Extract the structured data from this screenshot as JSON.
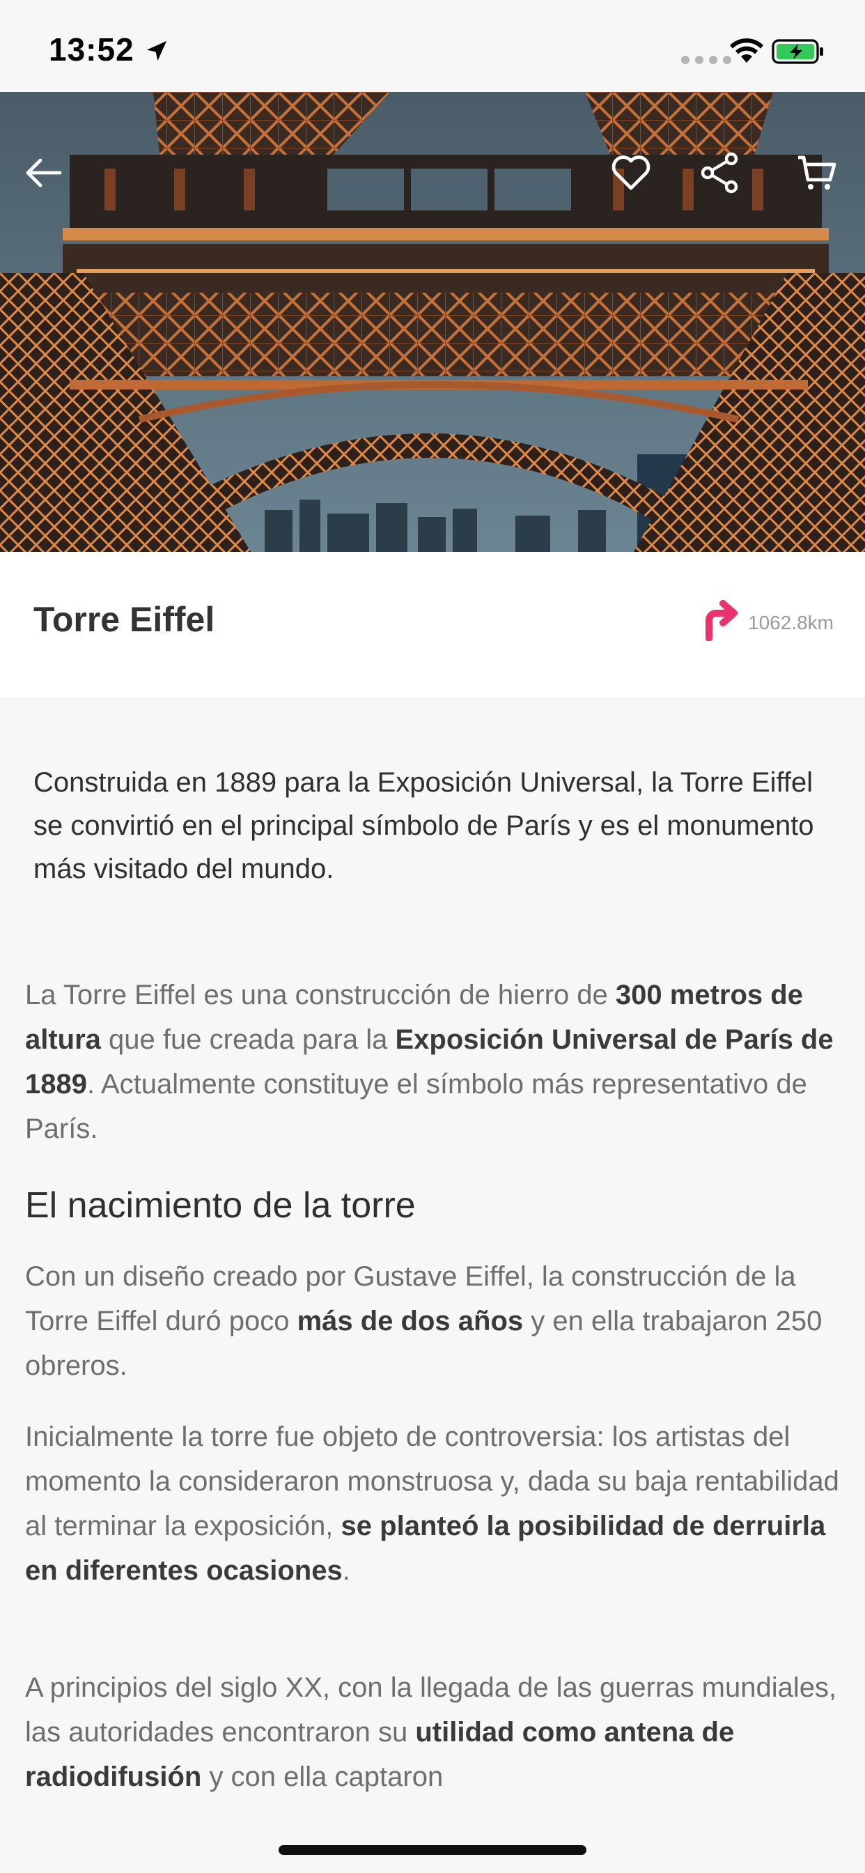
{
  "status_bar": {
    "time": "13:52"
  },
  "colors": {
    "accent": "#e8336f",
    "background": "#f7f7f7"
  },
  "hero": {
    "icons": [
      "back-arrow-icon",
      "heart-icon",
      "share-icon",
      "cart-icon"
    ]
  },
  "place": {
    "title": "Torre Eiffel",
    "distance": "1062.8km"
  },
  "content": {
    "intro": "Construida en 1889 para la Exposición Universal, la Torre Eiffel se convirtió en el principal símbolo de París y es el monumento más visitado del mundo.",
    "p1": {
      "t1": "La Torre Eiffel es una construcción de hierro de ",
      "b1": "300 metros de altura",
      "t2": " que fue creada para la ",
      "b2": "Exposición Universal de París de 1889",
      "t3": ". Actualmente constituye el símbolo más representativo de París."
    },
    "heading": "El nacimiento de la torre",
    "p2": {
      "t1": "Con un diseño creado por Gustave Eiffel, la construcción de la Torre Eiffel duró poco ",
      "b1": "más de dos años",
      "t2": " y en ella trabajaron 250 obreros."
    },
    "p3": {
      "t1": "Inicialmente la torre fue objeto de controversia: los artistas del momento la consideraron monstruosa y, dada su baja rentabilidad al terminar la exposición, ",
      "b1": "se planteó la posibilidad de derruirla en diferentes ocasiones",
      "t2": "."
    },
    "p4": {
      "t1": "A principios del siglo XX, con la llegada de las guerras mundiales, las autoridades encontraron su ",
      "b1": "utilidad como antena de radiodifusión",
      "t2": " y con ella captaron"
    }
  }
}
